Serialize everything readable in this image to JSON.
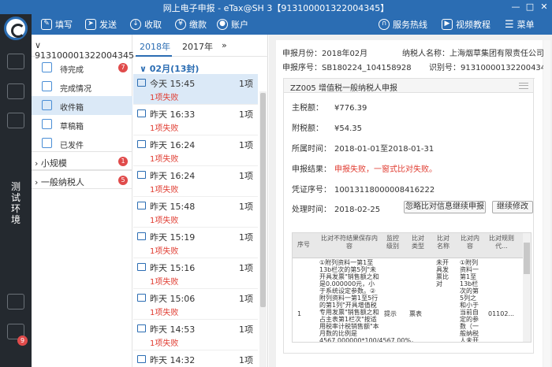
{
  "window": {
    "title": "网上电子申报 - eTax@SH 3【913100001322004345】",
    "min": "—",
    "max": "□",
    "close": "✕"
  },
  "toolbar": {
    "fill": "填写",
    "send": "发送",
    "receive": "收取",
    "pay": "缴款",
    "account": "账户",
    "hotline": "服务热线",
    "video": "视频教程",
    "menu": "菜单"
  },
  "rail": {
    "env_label": "测试环境",
    "badge": "9"
  },
  "nav": {
    "taxpayer_id": "913100001322004345",
    "items": [
      {
        "label": "待完成",
        "badge": "7",
        "icon": "clipboard-icon"
      },
      {
        "label": "完成情况",
        "badge": "",
        "icon": "document-icon"
      },
      {
        "label": "收件箱",
        "badge": "",
        "icon": "inbox-icon"
      },
      {
        "label": "草稿箱",
        "badge": "",
        "icon": "draft-icon"
      },
      {
        "label": "已发件",
        "badge": "",
        "icon": "sent-icon"
      }
    ],
    "groups": [
      {
        "label": "小规模",
        "badge": "1"
      },
      {
        "label": "一般纳税人",
        "badge": "5"
      }
    ]
  },
  "list": {
    "years": [
      "2018年",
      "2017年"
    ],
    "more": "»",
    "month": "02月(13封)",
    "messages": [
      {
        "time": "今天 15:45",
        "status": "1项失败",
        "count": "1项"
      },
      {
        "time": "昨天 16:33",
        "status": "1项失败",
        "count": "1项"
      },
      {
        "time": "昨天 16:24",
        "status": "1项失败",
        "count": "1项"
      },
      {
        "time": "昨天 16:24",
        "status": "1项失败",
        "count": "1项"
      },
      {
        "time": "昨天 15:48",
        "status": "1项失败",
        "count": "1项"
      },
      {
        "time": "昨天 15:19",
        "status": "1项失败",
        "count": "1项"
      },
      {
        "time": "昨天 15:16",
        "status": "1项失败",
        "count": "1项"
      },
      {
        "time": "昨天 15:06",
        "status": "1项失败",
        "count": "1项"
      },
      {
        "time": "昨天 14:53",
        "status": "1项失败",
        "count": "1项"
      },
      {
        "time": "昨天 14:32",
        "status": "1项失败",
        "count": "1项"
      }
    ]
  },
  "detail": {
    "month_label": "申报月份：",
    "month": "2018年02月",
    "payer_label": "纳税人名称：",
    "payer": "上海烟草集团有限责任公司",
    "seq_label": "申报序号：",
    "seq": "SB180224_104158928",
    "id_label": "识别号：",
    "id": "913100001322004345",
    "form_title": "ZZ005 增值税一般纳税人申报",
    "fields": [
      {
        "label": "主税额：",
        "value": "¥776.39"
      },
      {
        "label": "附税额：",
        "value": "¥54.35"
      },
      {
        "label": "所属时间：",
        "value": "2018-01-01至2018-01-31"
      },
      {
        "label": "申报结果：",
        "value": "申报失败，一窗式比对失败。"
      },
      {
        "label": "凭证序号：",
        "value": "10013118000008416222"
      },
      {
        "label": "处理时间：",
        "value": "2018-02-25"
      }
    ],
    "btn_ignore": "忽略比对信息继续申报",
    "btn_continue": "继续修改",
    "table": {
      "headers": [
        "序号",
        "比对不符结果保存内容",
        "监控级别",
        "比对类型",
        "比对名称",
        "比对内容",
        "比对规则代..."
      ],
      "row": {
        "no": "1",
        "content": "①附列资料一第1至13b栏次的第5列\"未开具发票\"销售额之和是0.000000元，小于系统设定参数。②附列资料一第1至5行的第1列\"开具增值税专用发票\"销售额之和占主表第1栏次\"按适用税率计税销售额\"本月数的比例是4567.000000*100/4567.00%，大于系统设定参数。③主表第34栏次\"本期应补(",
        "level": "提示",
        "type": "票表",
        "name": "未开具发票比对",
        "detail": "①附列资料一第1至13b栏次的第5列之和小于当前自定的参数（一般纳税人未开具发票比对参数1）。②附列资",
        "rule": "01102..."
      }
    }
  }
}
